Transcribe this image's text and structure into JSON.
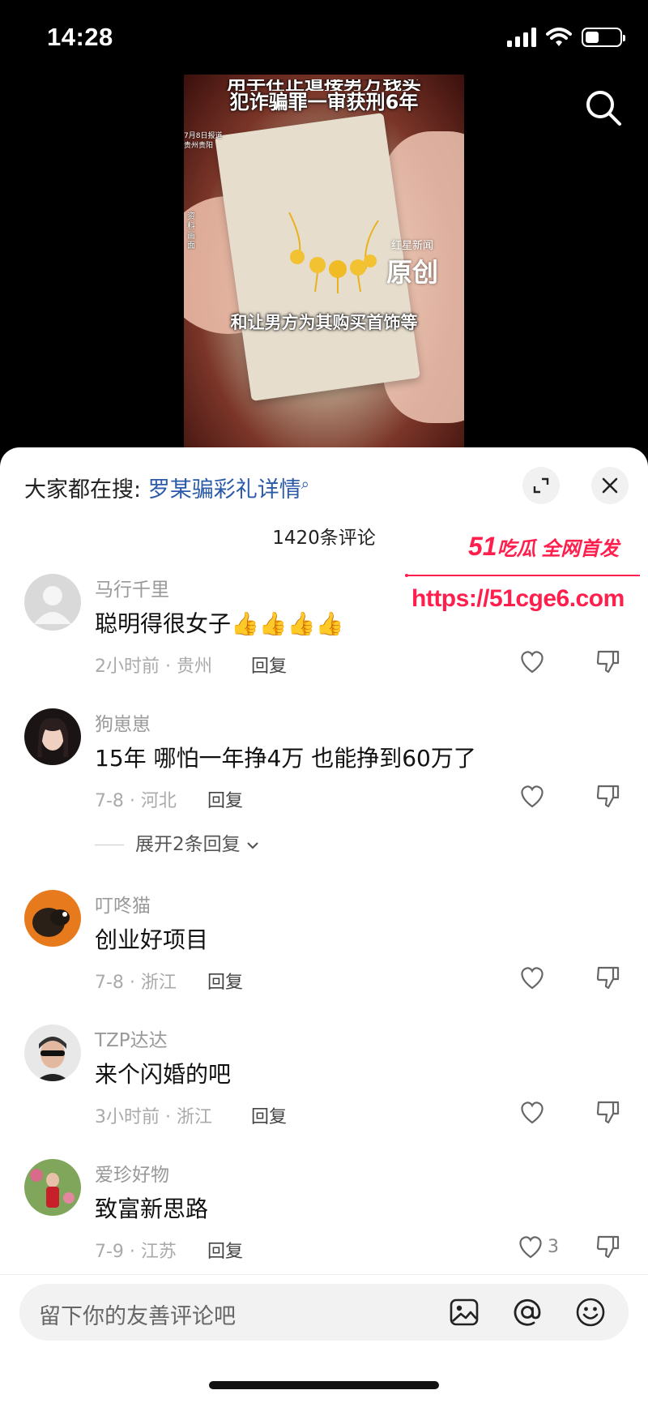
{
  "status_bar": {
    "time": "14:28"
  },
  "video": {
    "caption_top_cut": "用手在正道接男方钱买",
    "caption_top": "犯诈骗罪一审获刑6年",
    "date_line1": "7月8日报道",
    "date_line2": "贵州贵阳",
    "side_label": "资料画面",
    "brand_small": "红星新闻",
    "brand_big": "原创",
    "caption_bottom": "和让男方为其购买首饰等"
  },
  "sheet": {
    "search_prefix": "大家都在搜:",
    "search_link": "罗某骗彩礼详情",
    "comment_count": "1420条评论"
  },
  "watermark": {
    "title_num": "51",
    "title_rest": "吃瓜 全网首发",
    "url": "https://51cge6.com"
  },
  "comments": [
    {
      "user": "马行千里",
      "text": "聪明得很女子👍👍👍👍",
      "meta": "2小时前 · 贵州",
      "reply": "回复",
      "likes": ""
    },
    {
      "user": "狗崽崽",
      "text": "15年 哪怕一年挣4万 也能挣到60万了",
      "meta": "7-8 · 河北",
      "reply": "回复",
      "likes": "",
      "expand": "展开2条回复"
    },
    {
      "user": "叮咚猫",
      "text": "创业好项目",
      "meta": "7-8 · 浙江",
      "reply": "回复",
      "likes": ""
    },
    {
      "user": "TZP达达",
      "text": "来个闪婚的吧",
      "meta": "3小时前 · 浙江",
      "reply": "回复",
      "likes": ""
    },
    {
      "user": "爱珍好物",
      "text": "致富新思路",
      "meta": "7-9 · 江苏",
      "reply": "回复",
      "likes": "3"
    }
  ],
  "input": {
    "placeholder": "留下你的友善评论吧"
  },
  "battery_level": 0.4
}
